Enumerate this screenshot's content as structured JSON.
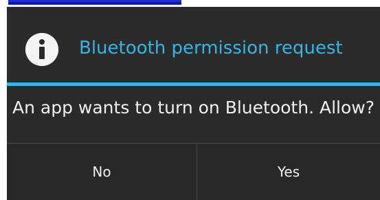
{
  "dialog": {
    "title": "Bluetooth permission request",
    "icon": "info-icon",
    "message": "An app wants to turn on Bluetooth. Allow?",
    "buttons": {
      "no_label": "No",
      "yes_label": "Yes"
    }
  },
  "colors": {
    "accent": "#33b5e5",
    "dialog_background": "#2b2b2b",
    "text": "#f0f0f0",
    "link_strip": "#1f2fd0"
  }
}
